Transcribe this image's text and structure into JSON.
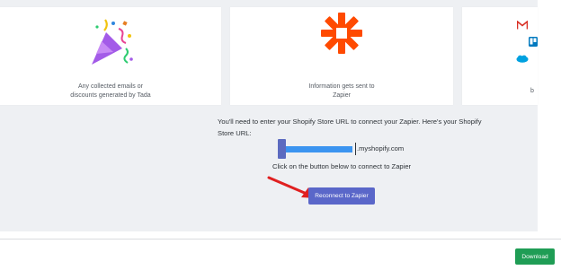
{
  "cards": [
    {
      "line1": "Any collected emails or",
      "line2": "discounts generated by Tada"
    },
    {
      "line1": "Information gets sent to",
      "line2": "Zapier"
    },
    {
      "glyph": "b"
    }
  ],
  "icons": {
    "card1": "party-popper-icon",
    "card2": "zapier-logo-icon",
    "card3": [
      "gmail-icon",
      "trello-icon",
      "salesforce-icon"
    ]
  },
  "connect": {
    "instruction": "You'll need to enter your Shopify Store URL to connect your Zapier. Here's your Shopify Store URL:",
    "url_suffix": ".myshopify.com",
    "click_hint": "Click on the button below to connect to Zapier",
    "button_label": "Reconnect to Zapier"
  },
  "footer": {
    "download_label": "Download"
  },
  "colors": {
    "accent": "#5a67c9",
    "zapier": "#ff4a00",
    "download": "#1f9d55",
    "arrow": "#e02020"
  }
}
